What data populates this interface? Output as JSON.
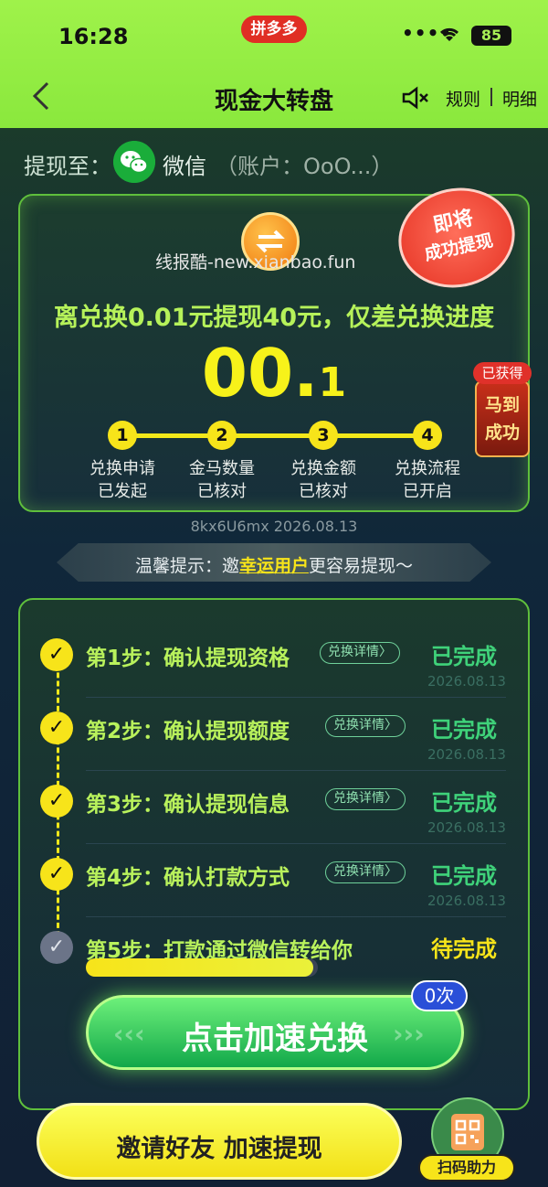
{
  "status": {
    "time": "16:28",
    "app_badge": "拼多多",
    "signal_dots": "••••",
    "battery": "85"
  },
  "nav": {
    "title": "现金大转盘",
    "rules": "规则",
    "detail": "明细"
  },
  "withdraw": {
    "label": "提现至：",
    "method": "微信",
    "account": "（账户：OoO...）"
  },
  "card": {
    "watermark": "线报酷-new.xianbao.fun",
    "stamp_line1": "即将",
    "stamp_line2": "成功提现",
    "headline": "离兑换0.01元提现40元，仅差兑换进度",
    "big_number_main": "00.",
    "big_number_tail": "1",
    "progress_steps": [
      {
        "num": "1",
        "line1": "兑换申请",
        "line2": "已发起"
      },
      {
        "num": "2",
        "line1": "金马数量",
        "line2": "已核对"
      },
      {
        "num": "3",
        "line1": "兑换金额",
        "line2": "已核对"
      },
      {
        "num": "4",
        "line1": "兑换流程",
        "line2": "已开启"
      }
    ],
    "side_badge": {
      "top": "已获得",
      "line1": "马到",
      "line2": "成功"
    }
  },
  "code_date": "8kx6U6mx 2026.08.13",
  "tip": {
    "prefix": "温馨提示：邀",
    "highlight": "幸运用户",
    "suffix": "更容易提现～"
  },
  "steps": [
    {
      "title": "第1步：确认提现资格",
      "detail": "兑换详情〉",
      "status": "已完成",
      "date": "2026.08.13"
    },
    {
      "title": "第2步：确认提现额度",
      "detail": "兑换详情〉",
      "status": "已完成",
      "date": "2026.08.13"
    },
    {
      "title": "第3步：确认提现信息",
      "detail": "兑换详情〉",
      "status": "已完成",
      "date": "2026.08.13"
    },
    {
      "title": "第4步：确认打款方式",
      "detail": "兑换详情〉",
      "status": "已完成",
      "date": "2026.08.13"
    },
    {
      "title": "第5步：打款通过微信转给你",
      "status": "待完成",
      "progress": 0.98
    }
  ],
  "speed_button": {
    "label": "点击加速兑换",
    "count_badge": "0次"
  },
  "invite_button": {
    "label": "邀请好友 加速提现"
  },
  "scan": {
    "label": "扫码助力"
  },
  "colors": {
    "accent_green": "#9ff24a",
    "yellow": "#f7e41a",
    "done_green": "#3fd27a"
  }
}
